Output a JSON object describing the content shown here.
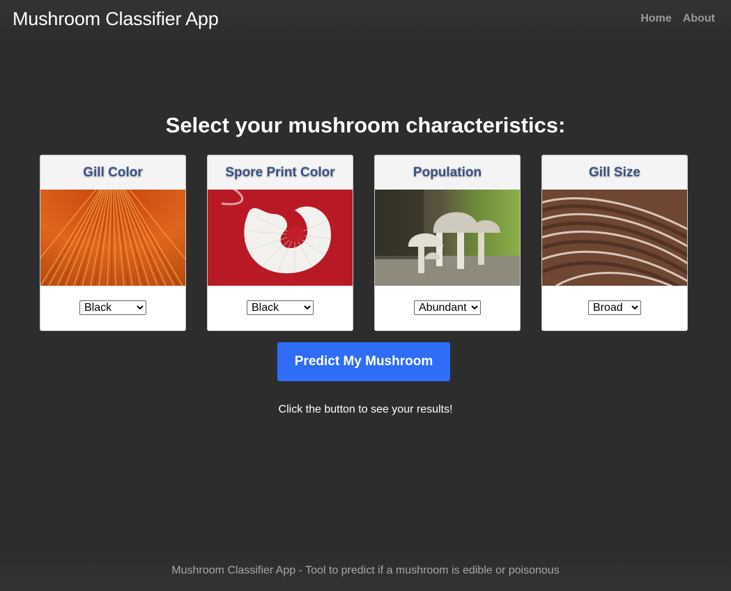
{
  "navbar": {
    "brand": "Mushroom Classifier App",
    "links": [
      "Home",
      "About"
    ]
  },
  "main": {
    "heading": "Select your mushroom characteristics:",
    "cards": [
      {
        "title": "Gill Color",
        "selected": "Black"
      },
      {
        "title": "Spore Print Color",
        "selected": "Black"
      },
      {
        "title": "Population",
        "selected": "Abundant"
      },
      {
        "title": "Gill Size",
        "selected": "Broad"
      }
    ],
    "predict_label": "Predict My Mushroom",
    "hint": "Click the button to see your results!"
  },
  "footer": {
    "text": "Mushroom Classifier App - Tool to predict if a mushroom is edible or poisonous"
  },
  "colors": {
    "background": "#2d2d2d",
    "accent": "#2f6df6",
    "card_title": "#3a5280"
  }
}
